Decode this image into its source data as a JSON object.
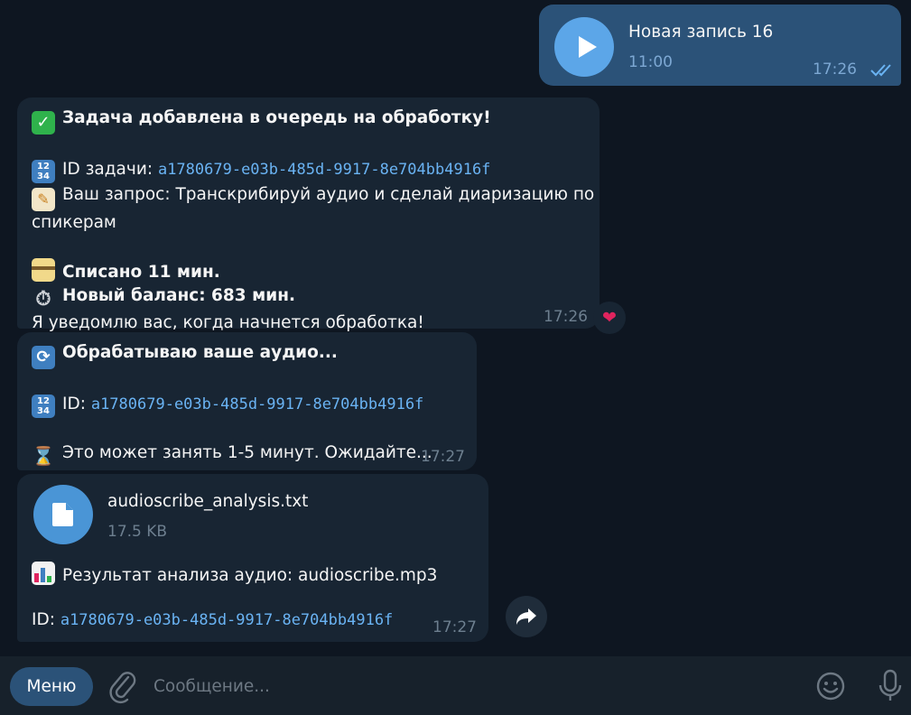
{
  "voice_msg": {
    "title": "Новая запись 16",
    "duration": "11:00",
    "time": "17:26"
  },
  "msg1": {
    "line_title": "Задача добавлена в очередь на обработку!",
    "id_label": "ID задачи: ",
    "id_value": "a1780679-e03b-485d-9917-8e704bb4916f",
    "request_label": "Ваш запрос: Транскрибируй аудио и сделай диаризацию по",
    "request_cont": "спикерам",
    "charged": "Списано 11 мин.",
    "balance": "Новый баланс: 683 мин.",
    "notify": "Я уведомлю вас, когда начнется обработка!",
    "time": "17:26",
    "reaction": "❤"
  },
  "msg2": {
    "line_title": "Обрабатываю ваше аудио...",
    "id_label": "ID: ",
    "id_value": "a1780679-e03b-485d-9917-8e704bb4916f",
    "wait": "Это может занять 1-5 минут. Ожидайте...",
    "time": "17:27"
  },
  "msg3": {
    "file_name": "audioscribe_analysis.txt",
    "file_size": "17.5 KB",
    "result": "Результат анализа аудио: audioscribe.mp3",
    "id_label": "ID: ",
    "id_value": "a1780679-e03b-485d-9917-8e704bb4916f",
    "time": "17:27"
  },
  "composer": {
    "menu_label": "Меню",
    "placeholder": "Сообщение..."
  },
  "colors": {
    "background": "#0e1621",
    "incoming_bubble": "#182533",
    "outgoing_bubble": "#2b5278",
    "link": "#6ab3f3",
    "accent": "#5ca6e8"
  },
  "icons": {
    "voice_play": "play-icon",
    "file": "document-icon",
    "read_status": "double-check-icon",
    "forward": "forward-arrow-icon",
    "attach": "paperclip-icon",
    "emoji": "smiley-icon",
    "mic": "microphone-icon"
  }
}
